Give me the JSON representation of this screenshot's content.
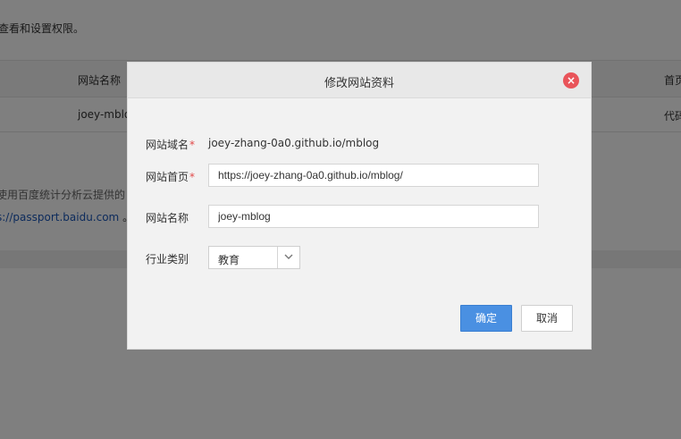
{
  "background": {
    "description_fragment": "查看和设置权限。",
    "table": {
      "header": {
        "col_site_name": "网站名称",
        "col_home": "首页"
      },
      "row": {
        "site_name": "joey-mblog",
        "code": "代码"
      }
    },
    "note_fragment": "使用百度统计分析云提供的",
    "link_fragment": "s://passport.baidu.com",
    "link_suffix": " 。"
  },
  "modal": {
    "title": "修改网站资料",
    "close_symbol": "×",
    "fields": {
      "domain": {
        "label": "网站域名",
        "required_mark": "*",
        "value": "joey-zhang-0a0.github.io/mblog"
      },
      "homepage": {
        "label": "网站首页",
        "required_mark": "*",
        "value": "https://joey-zhang-0a0.github.io/mblog/"
      },
      "site_name": {
        "label": "网站名称",
        "value": "joey-mblog"
      },
      "industry": {
        "label": "行业类别",
        "selected": "教育"
      }
    },
    "confirm_label": "确定",
    "cancel_label": "取消"
  },
  "icons": {
    "close": "close-icon",
    "dropdown": "chevron-down-icon"
  },
  "colors": {
    "primary": "#4a90e2",
    "close": "#e9545a",
    "required": "#e24a4a",
    "link": "#1a56b8"
  }
}
